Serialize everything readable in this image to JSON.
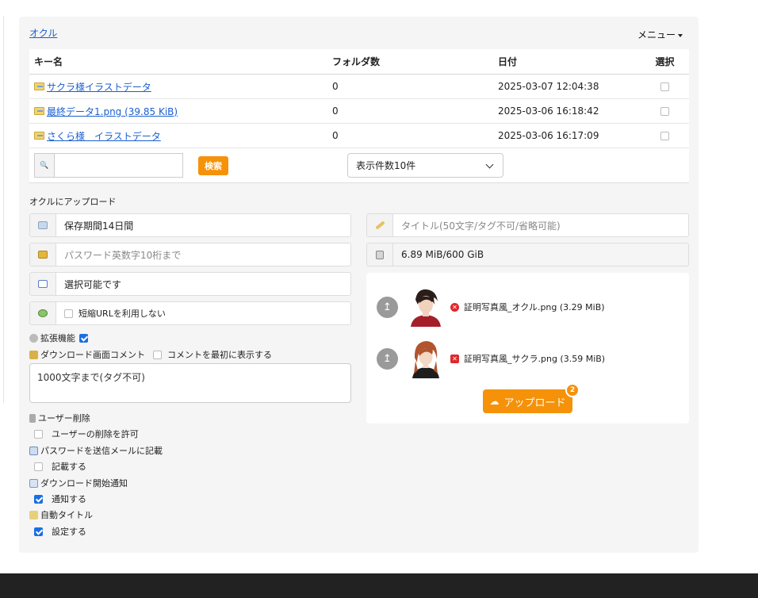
{
  "breadcrumb": "オクル",
  "menu_label": "メニュー",
  "table": {
    "headers": [
      "キー名",
      "フォルダ数",
      "日付",
      "選択"
    ],
    "rows": [
      {
        "name": "サクラ様イラストデータ",
        "count": "0",
        "date": "2025-03-07 12:04:38"
      },
      {
        "name": "最終データ1.png (39.85 KiB)",
        "count": "0",
        "date": "2025-03-06 16:18:42"
      },
      {
        "name": "さくら様　イラストデータ",
        "count": "0",
        "date": "2025-03-06 16:17:09"
      }
    ]
  },
  "search": {
    "placeholder": "",
    "button": "検索",
    "page_size": "表示件数10件"
  },
  "upload": {
    "section_title": "オクルにアップロード",
    "retention": "保存期間14日間",
    "password_placeholder": "パスワード英数字10桁まで",
    "email": "選択可能です",
    "short_url_label": "短縮URLを利用しない",
    "title_placeholder": "タイトル(50文字/タグ不可/省略可能)",
    "capacity": "6.89 MiB/600 GiB",
    "ext_label": "拡張機能",
    "comment_label": "ダウンロード画面コメント",
    "comment_first_label": "コメントを最初に表示する",
    "comment_placeholder": "1000文字まで(タグ不可)",
    "user_delete_title": "ユーザー削除",
    "user_delete_label": "ユーザーの削除を許可",
    "pw_mail_title": "パスワードを送信メールに記載",
    "pw_mail_label": "記載する",
    "notify_title": "ダウンロード開始通知",
    "notify_label": "通知する",
    "autotitle_title": "自動タイトル",
    "autotitle_label": "設定する",
    "files": [
      {
        "name": "証明写真風_オクル.png (3.29 MiB)"
      },
      {
        "name": "証明写真風_サクラ.png (3.59 MiB)"
      }
    ],
    "upload_button": "アップロード",
    "upload_count": "2"
  },
  "colors": {
    "accent": "#f5920a",
    "link": "#1a5fd0",
    "panel": "#f5f5f5",
    "footer": "#222222"
  }
}
